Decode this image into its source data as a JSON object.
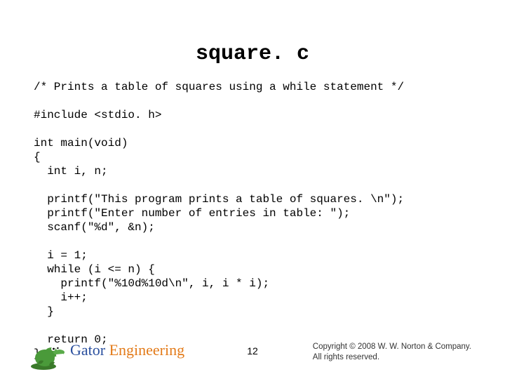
{
  "title": "square. c",
  "code": "/* Prints a table of squares using a while statement */\n\n#include <stdio. h>\n\nint main(void)\n{\n  int i, n;\n\n  printf(\"This program prints a table of squares. \\n\");\n  printf(\"Enter number of entries in table: \");\n  scanf(\"%d\", &n);\n\n  i = 1;\n  while (i <= n) {\n    printf(\"%10d%10d\\n\", i, i * i);\n    i++;\n  }\n\n  return 0;\n}",
  "footer": {
    "brand_first": "Gator ",
    "brand_second": "Engineering",
    "page_number": "12",
    "copyright_line1": "Copyright © 2008 W. W. Norton & Company.",
    "copyright_line2": "All rights reserved."
  }
}
